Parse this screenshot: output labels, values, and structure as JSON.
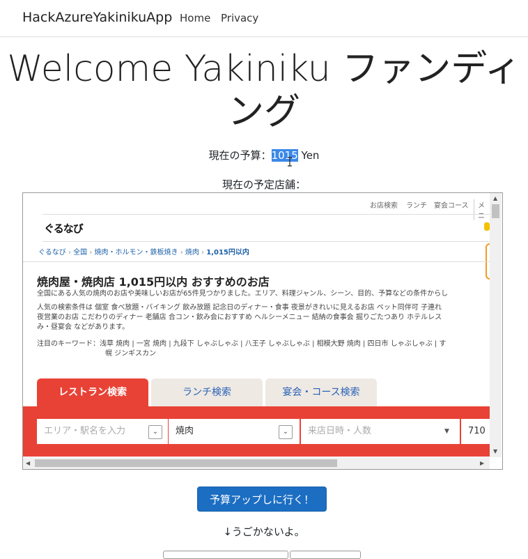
{
  "navbar": {
    "brand": "HackAzureYakinikuApp",
    "links": [
      "Home",
      "Privacy"
    ]
  },
  "heading": "Welcome Yakiniku ファンディング",
  "budget": {
    "label": "現在の予算：",
    "value": "1015",
    "unit": "Yen"
  },
  "planned_label": "現在の予定店舗：",
  "embed": {
    "top_links": [
      "お店検索",
      "ランチ",
      "宴会コース",
      "メニ"
    ],
    "logo": "ぐるなび",
    "breadcrumb": [
      "ぐるなび",
      "全国",
      "焼肉・ホルモン・鉄板焼き",
      "焼肉",
      "1,015円以内"
    ],
    "title": "焼肉屋・焼肉店 1,015円以内 おすすめのお店",
    "desc": "全国にある人気の焼肉のお店や美味しいお店が65件見つかりました。エリア、料理ジャンル、シーン、目的、予算などの条件からし",
    "popular_1": "人気の検索条件は 個室 食べ放題・バイキング 飲み放題 記念日のディナー・食事 夜景がきれいに見えるお店 ペット同伴可 子連れ",
    "popular_2": "夜営業のお店 こだわりのディナー 老舗店 合コン・飲み会におすすめ ヘルシーメニュー 結納の食事会 掘りごたつあり ホテルレス",
    "popular_3": "み・昼宴会 などがあります。",
    "keywords_1": "注目のキーワード：浅草 焼肉 | 一宮 焼肉 | 九段下 しゃぶしゃぶ | 八王子 しゃぶしゃぶ | 相模大野 焼肉 | 四日市 しゃぶしゃぶ | す",
    "keywords_2": "幌 ジンギスカン",
    "tabs": [
      "レストラン検索",
      "ランチ検索",
      "宴会・コース検索"
    ],
    "search": {
      "area_placeholder": "エリア・駅名を入力",
      "genre_value": "焼肉",
      "datetime_placeholder": "来店日時・人数",
      "budget_partial": "710"
    },
    "colors": {
      "accent_red": "#e84236",
      "link_blue": "#1a5fa8",
      "mascot": "#f29b1d"
    }
  },
  "button_label": "予算アップしに行く！",
  "note": "↓うごかないよ。"
}
